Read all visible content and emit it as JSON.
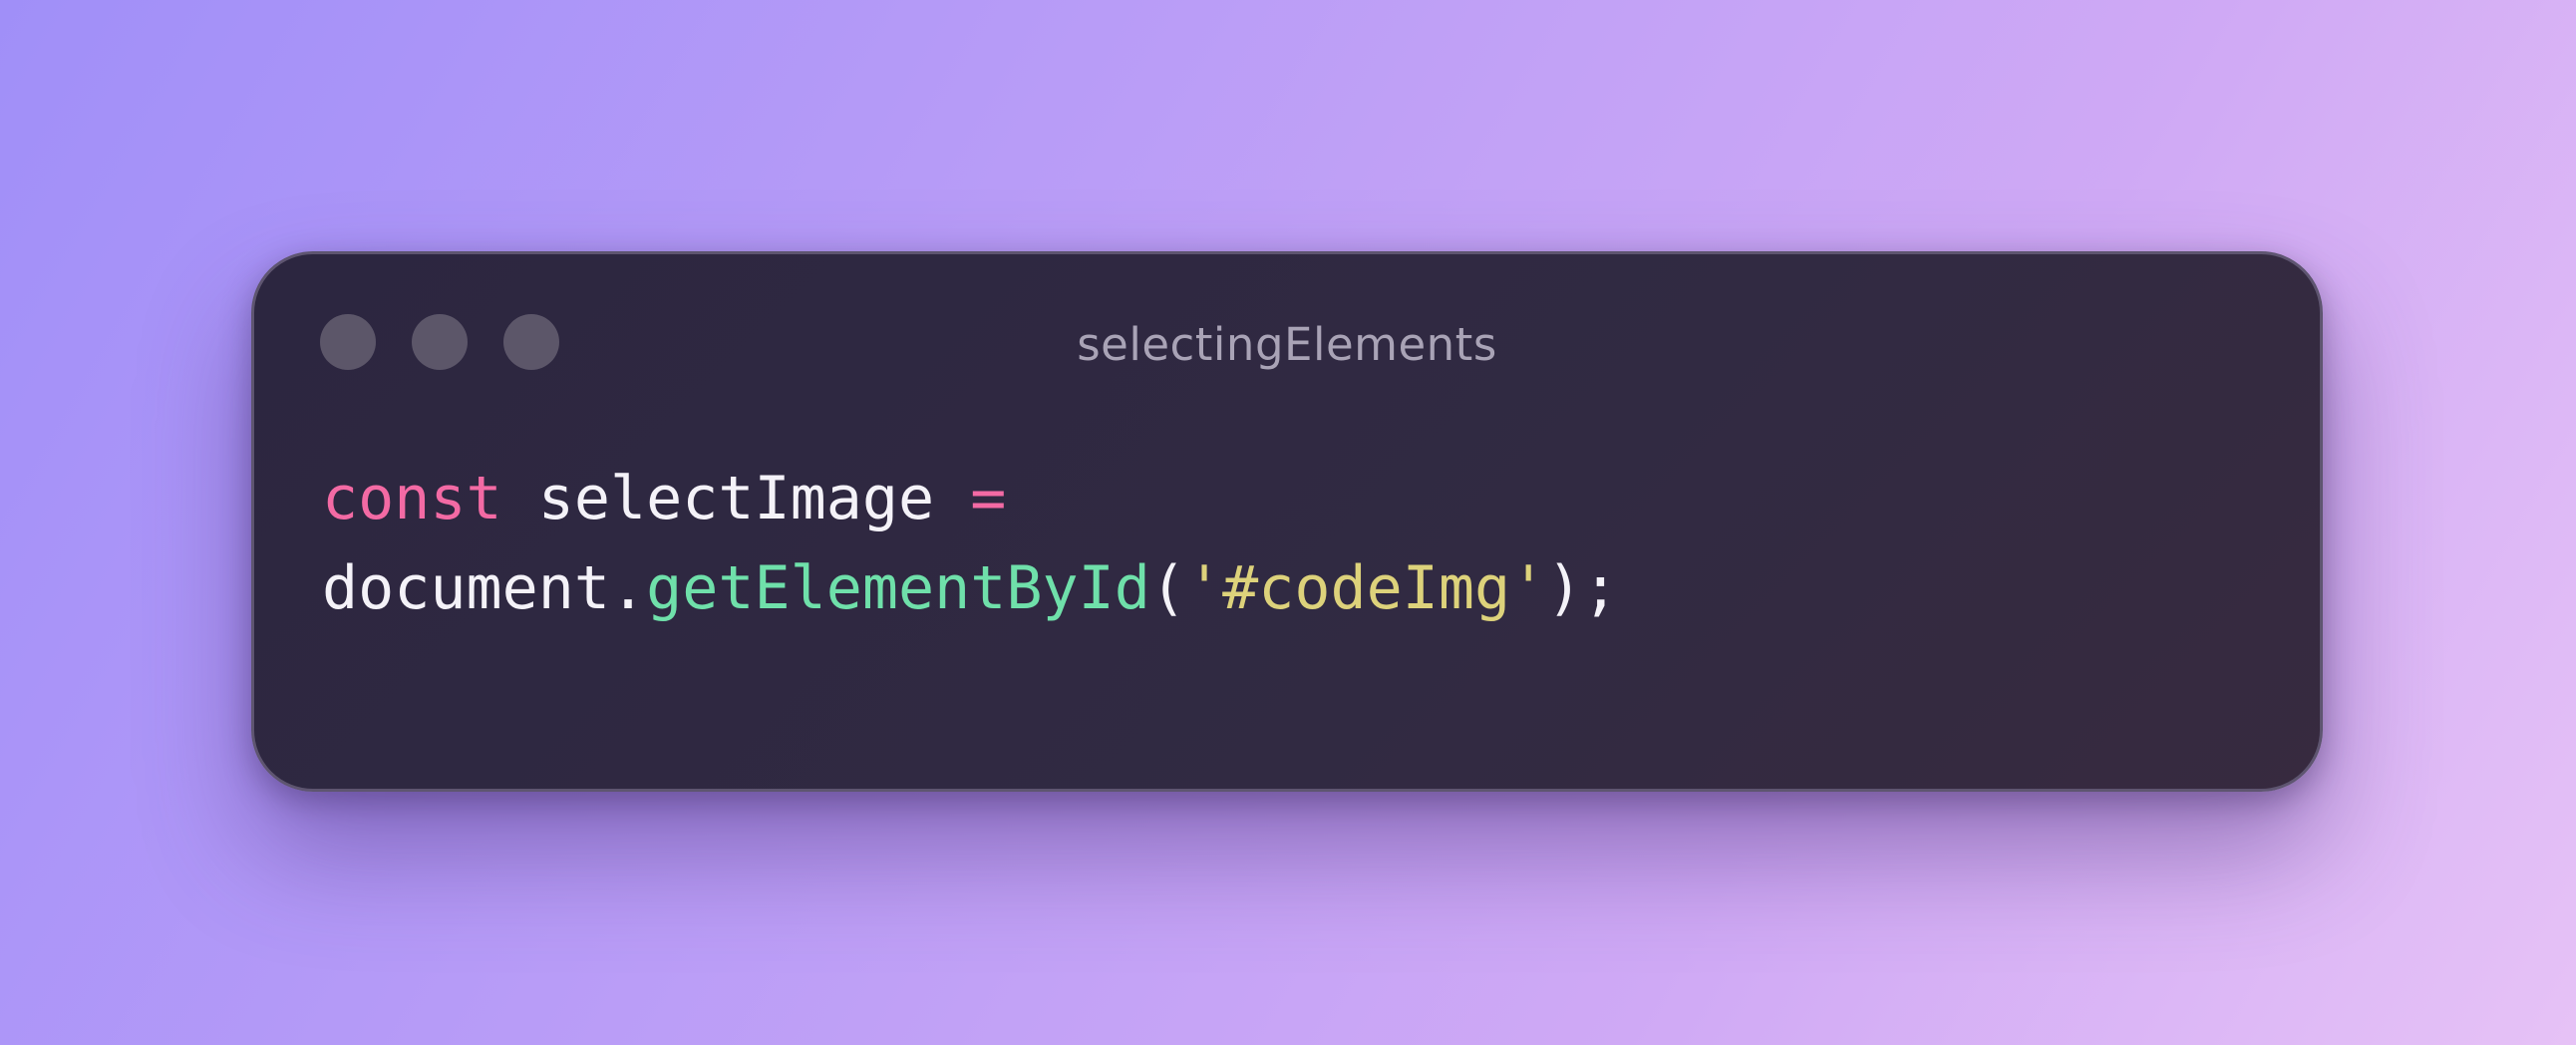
{
  "window": {
    "title": "selectingElements",
    "controls": [
      "close-dot",
      "minimize-dot",
      "maximize-dot"
    ]
  },
  "code": {
    "line1": {
      "keyword": "const",
      "identifier": "selectImage",
      "operator": "="
    },
    "line2": {
      "object": "document.",
      "method": "getElementById",
      "open_paren": "(",
      "string": "'#codeImg'",
      "close": ");"
    }
  },
  "colors": {
    "keyword": "#f36aa4",
    "function": "#6fe0aa",
    "string": "#ddd27b",
    "text": "#f4f2f8",
    "window_bg": "#2e2842"
  }
}
